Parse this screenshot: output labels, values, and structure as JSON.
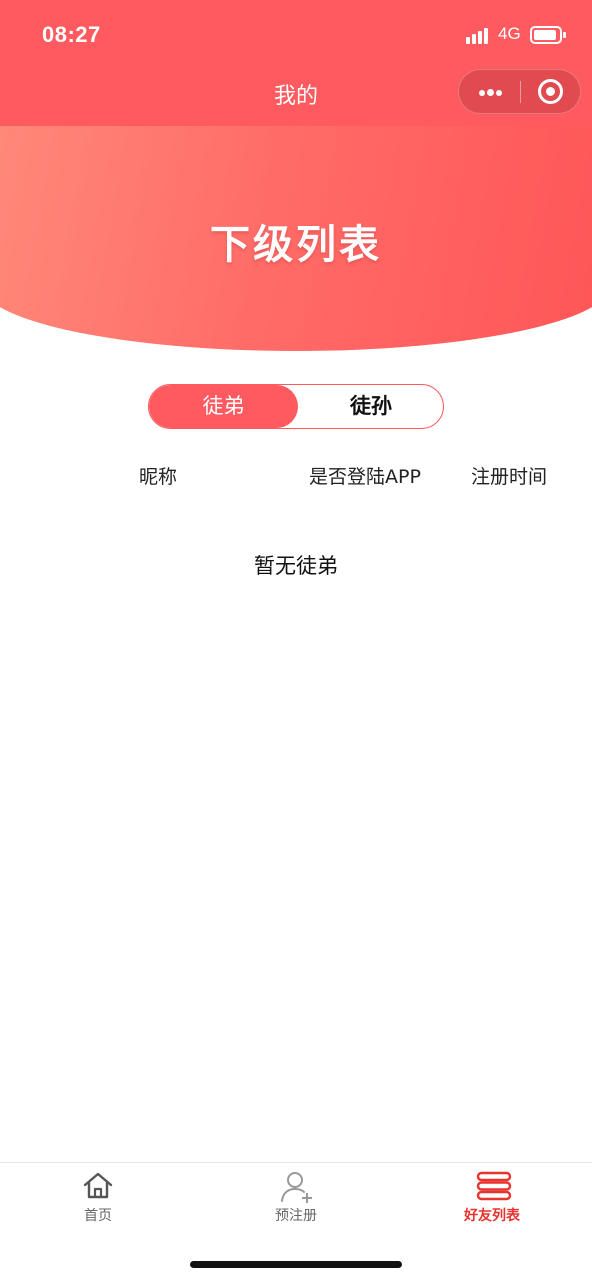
{
  "status_bar": {
    "time": "08:27",
    "network": "4G"
  },
  "nav": {
    "title": "我的"
  },
  "hero": {
    "title": "下级列表"
  },
  "segment": {
    "tabs": [
      {
        "label": "徒弟",
        "active": true
      },
      {
        "label": "徒孙",
        "active": false
      }
    ]
  },
  "table": {
    "columns": [
      "昵称",
      "是否登陆APP",
      "注册时间"
    ]
  },
  "empty_state": "暂无徒弟",
  "tabbar": {
    "items": [
      {
        "label": "首页",
        "icon": "home-icon",
        "active": false
      },
      {
        "label": "预注册",
        "icon": "add-user-icon",
        "active": false
      },
      {
        "label": "好友列表",
        "icon": "list-icon",
        "active": true
      }
    ]
  },
  "colors": {
    "primary": "#ff5a5f",
    "active_tab": "#e8332f"
  }
}
